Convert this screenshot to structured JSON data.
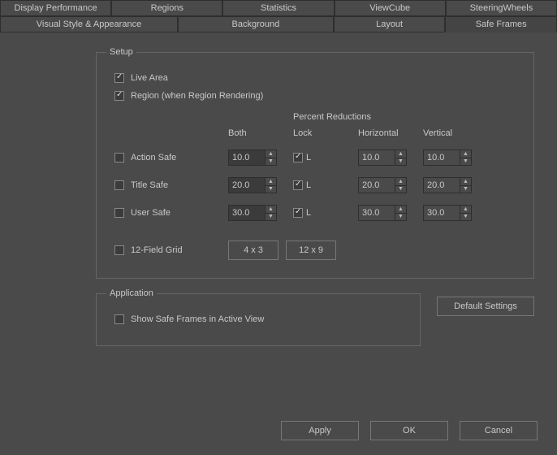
{
  "tabs_row1": [
    {
      "label": "Display Performance"
    },
    {
      "label": "Regions"
    },
    {
      "label": "Statistics"
    },
    {
      "label": "ViewCube"
    },
    {
      "label": "SteeringWheels"
    }
  ],
  "tabs_row2": [
    {
      "label": "Visual Style & Appearance"
    },
    {
      "label": "Background"
    },
    {
      "label": "Layout"
    },
    {
      "label": "Safe Frames",
      "active": true
    }
  ],
  "setup": {
    "legend": "Setup",
    "live_area": "Live Area",
    "region": "Region (when Region Rendering)",
    "percent_reductions": "Percent Reductions",
    "cols": {
      "both": "Both",
      "lock": "Lock",
      "horizontal": "Horizontal",
      "vertical": "Vertical"
    },
    "rows": [
      {
        "name": "action-safe",
        "label": "Action Safe",
        "checked": false,
        "both": "10.0",
        "lock": true,
        "h": "10.0",
        "v": "10.0"
      },
      {
        "name": "title-safe",
        "label": "Title Safe",
        "checked": false,
        "both": "20.0",
        "lock": true,
        "h": "20.0",
        "v": "20.0"
      },
      {
        "name": "user-safe",
        "label": "User Safe",
        "checked": false,
        "both": "30.0",
        "lock": true,
        "h": "30.0",
        "v": "30.0"
      }
    ],
    "grid": {
      "label": "12-Field Grid",
      "btn1": "4 x 3",
      "btn2": "12 x 9"
    }
  },
  "application": {
    "legend": "Application",
    "show_safe": "Show Safe Frames in Active View"
  },
  "default_settings": "Default Settings",
  "footer": {
    "apply": "Apply",
    "ok": "OK",
    "cancel": "Cancel"
  }
}
